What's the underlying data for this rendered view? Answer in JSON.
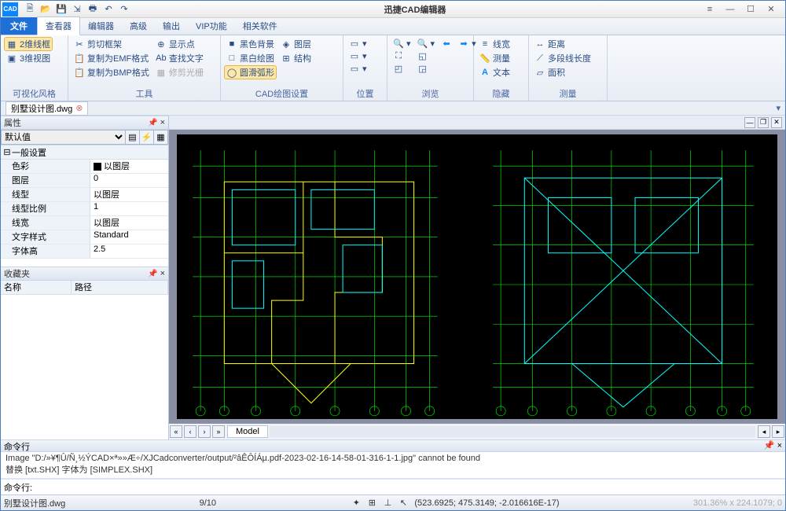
{
  "app": {
    "title": "迅捷CAD编辑器",
    "logo": "CAD"
  },
  "qat": [
    "new",
    "open",
    "save",
    "export",
    "print",
    "undo",
    "redo"
  ],
  "window_buttons": {
    "menu": "≡",
    "min": "—",
    "max": "☐",
    "close": "✕"
  },
  "tabs": {
    "file": "文件",
    "items": [
      {
        "id": "viewer",
        "label": "查看器",
        "active": true
      },
      {
        "id": "editor",
        "label": "编辑器"
      },
      {
        "id": "advanced",
        "label": "高级"
      },
      {
        "id": "output",
        "label": "输出"
      },
      {
        "id": "vip",
        "label": "VIP功能"
      },
      {
        "id": "related",
        "label": "相关软件"
      }
    ]
  },
  "ribbon": {
    "g1": {
      "label": "可视化风格",
      "btns": [
        {
          "id": "2d-wire",
          "label": "2维线框",
          "ico": "▦",
          "hl": true
        },
        {
          "id": "3d-view",
          "label": "3维视图",
          "ico": "▣"
        }
      ]
    },
    "g2": {
      "label": "工具",
      "btns": [
        {
          "id": "cut-frame",
          "label": "剪切框架",
          "ico": "✂"
        },
        {
          "id": "copy-emf",
          "label": "复制为EMF格式",
          "ico": "📋"
        },
        {
          "id": "copy-bmp",
          "label": "复制为BMP格式",
          "ico": "📋"
        },
        {
          "id": "show-point",
          "label": "显示点",
          "ico": "⊕"
        },
        {
          "id": "find-text",
          "label": "查找文字",
          "ico": "Ab"
        },
        {
          "id": "trim-light",
          "label": "修剪光栅",
          "ico": "▦",
          "disabled": true
        }
      ]
    },
    "g3": {
      "label": "CAD绘图设置",
      "btns": [
        {
          "id": "black-bg",
          "label": "黑色背景",
          "ico": "■"
        },
        {
          "id": "bw-draw",
          "label": "黑白绘图",
          "ico": "□"
        },
        {
          "id": "round-arc",
          "label": "圆滑弧形",
          "ico": "◯",
          "hl": true
        },
        {
          "id": "layers",
          "label": "图层",
          "ico": "◈"
        },
        {
          "id": "structure",
          "label": "结构",
          "ico": "⊞"
        }
      ]
    },
    "g4": {
      "label": "位置"
    },
    "g5": {
      "label": "浏览"
    },
    "g6": {
      "label": "隐藏",
      "btns": [
        {
          "id": "linewidth",
          "label": "线宽",
          "ico": "≡"
        },
        {
          "id": "measure",
          "label": "测量",
          "ico": "📏"
        },
        {
          "id": "text",
          "label": "文本",
          "ico": "A"
        }
      ]
    },
    "g7": {
      "label": "测量",
      "btns": [
        {
          "id": "distance",
          "label": "距离",
          "ico": "↔"
        },
        {
          "id": "polyline-len",
          "label": "多段线长度",
          "ico": "⟋"
        },
        {
          "id": "area",
          "label": "面积",
          "ico": "▱"
        }
      ]
    }
  },
  "document": {
    "tab_name": "别墅设计图.dwg"
  },
  "props_panel": {
    "title": "属性",
    "selector": "默认值",
    "group": "一般设置",
    "rows": [
      {
        "k": "色彩",
        "v": "以图层",
        "swatch": true
      },
      {
        "k": "图层",
        "v": "0"
      },
      {
        "k": "线型",
        "v": "以图层"
      },
      {
        "k": "线型比例",
        "v": "1"
      },
      {
        "k": "线宽",
        "v": "以图层"
      },
      {
        "k": "文字样式",
        "v": "Standard"
      },
      {
        "k": "字体高",
        "v": "2.5"
      }
    ]
  },
  "fav_panel": {
    "title": "收藏夹",
    "col1": "名称",
    "col2": "路径"
  },
  "model_tab": "Model",
  "cmd": {
    "title": "命令行",
    "log1": "Image \"D:/»¥¶Û/Ñ¸½ÝCAD×ª»»Æ÷/XJCadconverter/output/²âÊÔÍÁµ.pdf-2023-02-16-14-58-01-316-1-1.jpg\" cannot be found",
    "log2": "替换 [txt.SHX] 字体为 [SIMPLEX.SHX]",
    "prompt": "命令行:"
  },
  "status": {
    "filename": "别墅设计图.dwg",
    "page": "9/10",
    "coords": "(523.6925; 475.3149; -2.016616E-17)",
    "zoom": "301.36% x 224.1079; 0"
  }
}
